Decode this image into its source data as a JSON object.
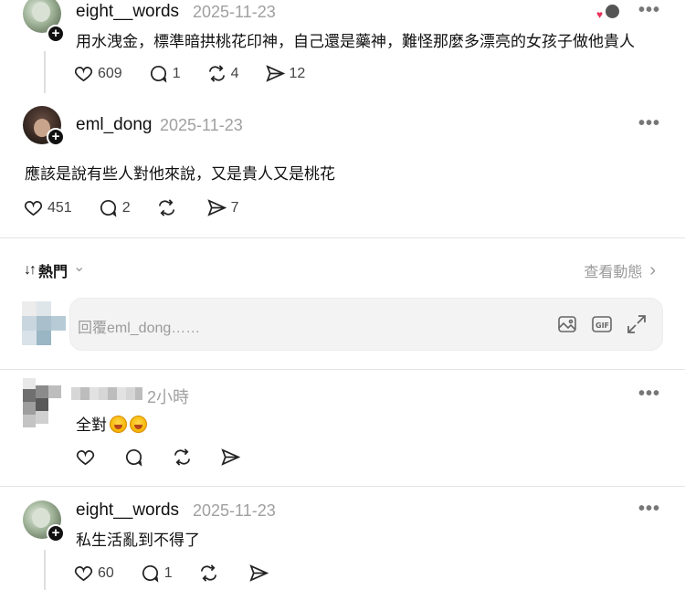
{
  "post1": {
    "username": "eight__words",
    "date": "2025-11-23",
    "more": "•••",
    "text": "用水洩金，標準暗拱桃花印神，自己還是藥神，難怪那麼多漂亮的女孩子做他貴人",
    "likes": "609",
    "replies": "1",
    "reposts": "4",
    "shares": "12"
  },
  "post2": {
    "username": "eml_dong",
    "date": "2025-11-23",
    "more": "•••",
    "text": "應該是說有些人對他來說，又是貴人又是桃花",
    "likes": "451",
    "replies": "2",
    "reposts": "",
    "shares": "7"
  },
  "sort": {
    "arrow": "↓↑",
    "label": "熱門",
    "chevron": "⌄",
    "view_activity": "查看動態",
    "view_chevron": "›"
  },
  "reply": {
    "placeholder": "回覆eml_dong……"
  },
  "comment": {
    "time": "2小時",
    "more": "•••",
    "text": "全對"
  },
  "post3": {
    "username": "eight__words",
    "date": "2025-11-23",
    "more": "•••",
    "text": "私生活亂到不得了",
    "likes": "60",
    "replies": "1"
  },
  "colors": {
    "text": "#111111",
    "muted": "#a0a0a0",
    "divider": "#e4e4e4",
    "reply_bg": "#f3f3f3"
  }
}
